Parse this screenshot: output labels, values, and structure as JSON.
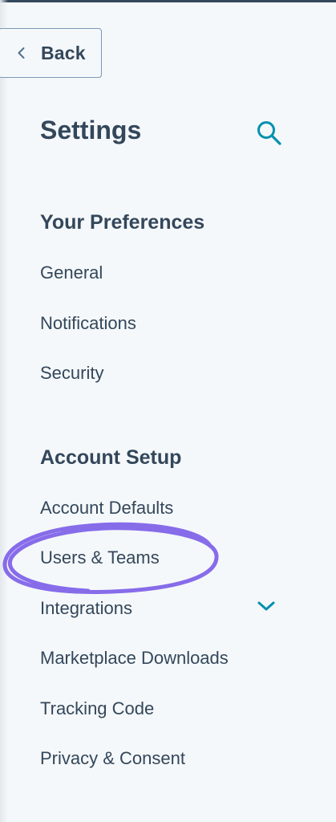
{
  "header": {
    "back_label": "Back",
    "title": "Settings"
  },
  "sections": [
    {
      "heading": "Your Preferences",
      "items": [
        "General",
        "Notifications",
        "Security"
      ]
    },
    {
      "heading": "Account Setup",
      "items": [
        "Account Defaults",
        "Users & Teams",
        "Integrations",
        "Marketplace Downloads",
        "Tracking Code",
        "Privacy & Consent"
      ]
    }
  ],
  "colors": {
    "text": "#33475b",
    "accent_teal": "#0091ae",
    "annotation_purple": "#7b5ce8",
    "background": "#f5f8fa"
  },
  "icons": {
    "back": "chevron-left-icon",
    "search": "search-icon",
    "expand": "chevron-down-icon"
  }
}
